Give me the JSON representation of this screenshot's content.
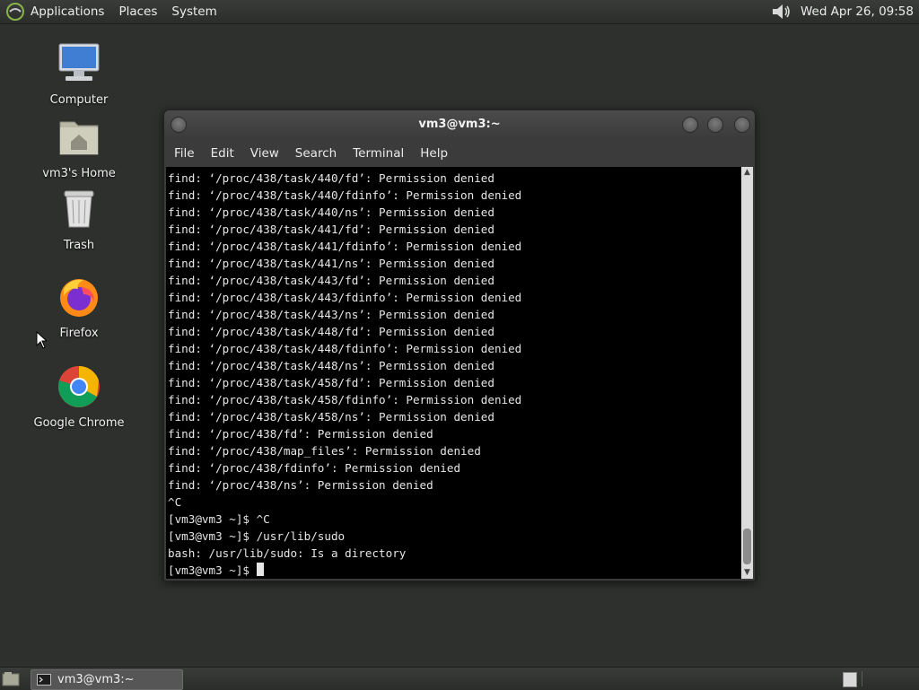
{
  "top_panel": {
    "menus": [
      "Applications",
      "Places",
      "System"
    ],
    "clock": "Wed Apr 26, 09:58"
  },
  "desktop_icons": [
    {
      "label": "Computer",
      "icon": "computer-icon"
    },
    {
      "label": "vm3's Home",
      "icon": "home-folder-icon"
    },
    {
      "label": "Trash",
      "icon": "trash-icon"
    },
    {
      "label": "Firefox",
      "icon": "firefox-icon"
    },
    {
      "label": "Google Chrome",
      "icon": "chrome-icon"
    }
  ],
  "terminal": {
    "title": "vm3@vm3:~",
    "menu": [
      "File",
      "Edit",
      "View",
      "Search",
      "Terminal",
      "Help"
    ],
    "lines": [
      "find: ‘/proc/438/task/440/fd’: Permission denied",
      "find: ‘/proc/438/task/440/fdinfo’: Permission denied",
      "find: ‘/proc/438/task/440/ns’: Permission denied",
      "find: ‘/proc/438/task/441/fd’: Permission denied",
      "find: ‘/proc/438/task/441/fdinfo’: Permission denied",
      "find: ‘/proc/438/task/441/ns’: Permission denied",
      "find: ‘/proc/438/task/443/fd’: Permission denied",
      "find: ‘/proc/438/task/443/fdinfo’: Permission denied",
      "find: ‘/proc/438/task/443/ns’: Permission denied",
      "find: ‘/proc/438/task/448/fd’: Permission denied",
      "find: ‘/proc/438/task/448/fdinfo’: Permission denied",
      "find: ‘/proc/438/task/448/ns’: Permission denied",
      "find: ‘/proc/438/task/458/fd’: Permission denied",
      "find: ‘/proc/438/task/458/fdinfo’: Permission denied",
      "find: ‘/proc/438/task/458/ns’: Permission denied",
      "find: ‘/proc/438/fd’: Permission denied",
      "find: ‘/proc/438/map_files’: Permission denied",
      "find: ‘/proc/438/fdinfo’: Permission denied",
      "find: ‘/proc/438/ns’: Permission denied",
      "^C",
      "[vm3@vm3 ~]$ ^C",
      "[vm3@vm3 ~]$ /usr/lib/sudo",
      "bash: /usr/lib/sudo: Is a directory"
    ],
    "prompt": "[vm3@vm3 ~]$ "
  },
  "taskbar": {
    "window_button": "vm3@vm3:~"
  }
}
